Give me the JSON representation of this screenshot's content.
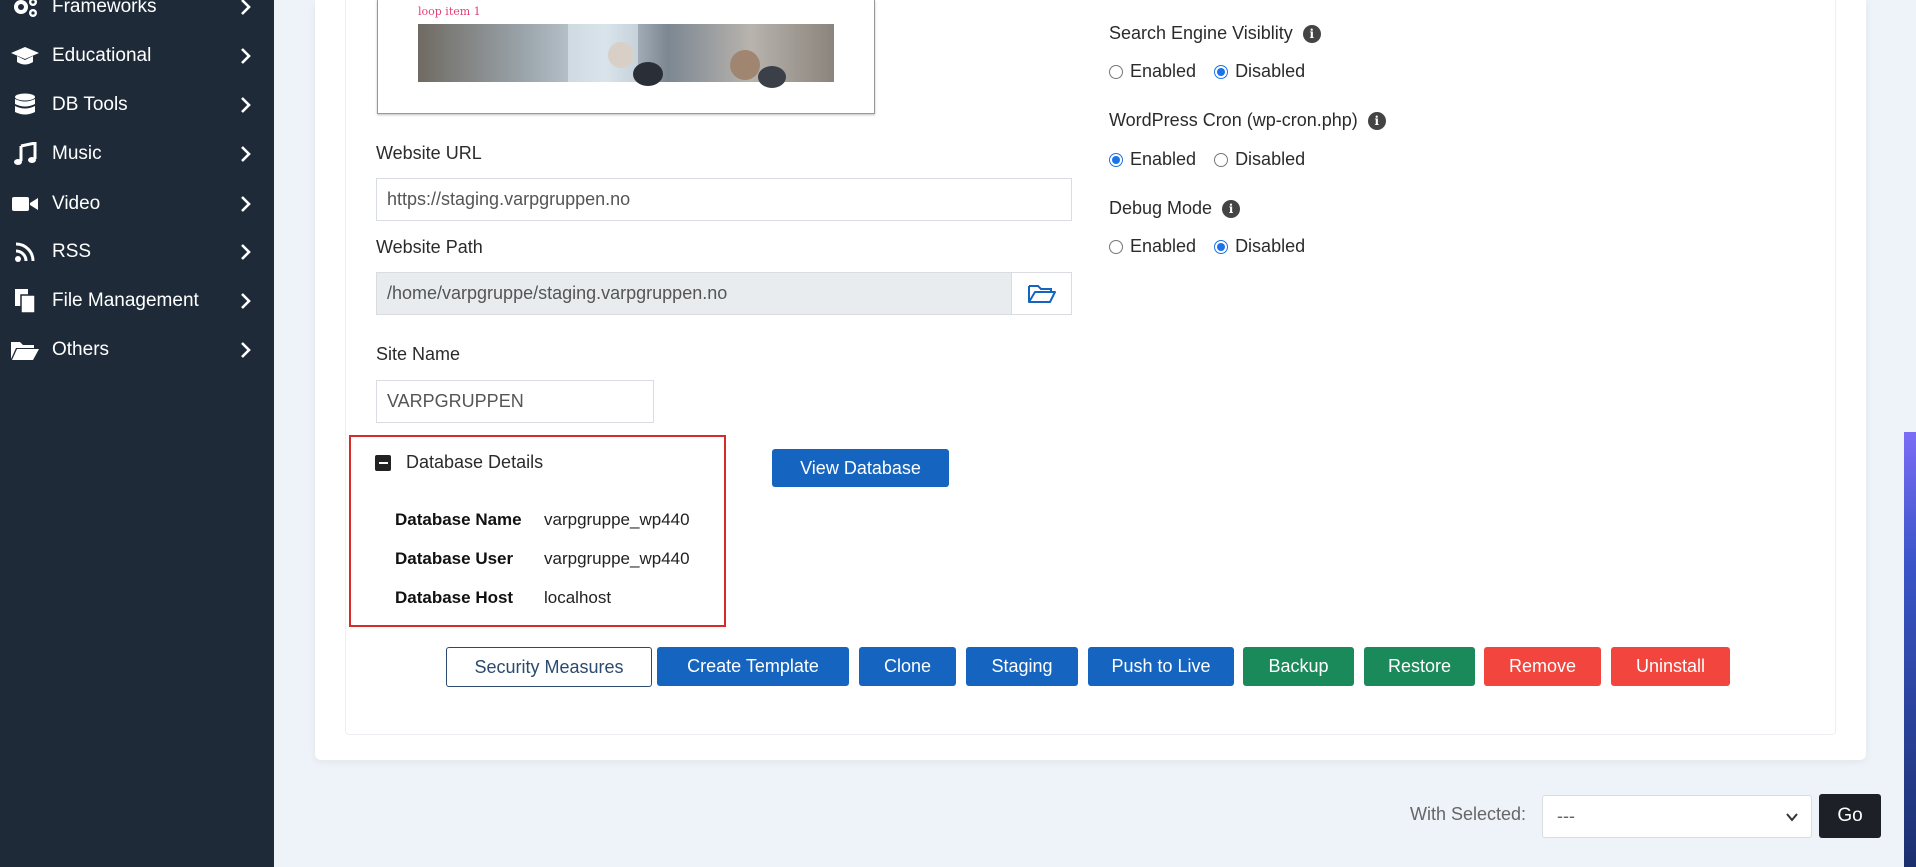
{
  "sidebar": {
    "items": [
      {
        "label": "Frameworks",
        "icon": "gears-icon"
      },
      {
        "label": "Educational",
        "icon": "graduation-cap-icon"
      },
      {
        "label": "DB Tools",
        "icon": "database-icon"
      },
      {
        "label": "Music",
        "icon": "music-note-icon"
      },
      {
        "label": "Video",
        "icon": "video-camera-icon"
      },
      {
        "label": "RSS",
        "icon": "rss-icon"
      },
      {
        "label": "File Management",
        "icon": "files-icon"
      },
      {
        "label": "Others",
        "icon": "folder-open-icon"
      }
    ]
  },
  "preview": {
    "caption": "loop item 1"
  },
  "form": {
    "website_url_label": "Website URL",
    "website_url_value": "https://staging.varpgruppen.no",
    "website_path_label": "Website Path",
    "website_path_value": "/home/varpgruppe/staging.varpgruppen.no",
    "site_name_label": "Site Name",
    "site_name_value": "VARPGRUPPEN"
  },
  "database": {
    "title": "Database Details",
    "rows": [
      {
        "key": "Database Name",
        "value": "varpgruppe_wp440"
      },
      {
        "key": "Database User",
        "value": "varpgruppe_wp440"
      },
      {
        "key": "Database Host",
        "value": "localhost"
      }
    ],
    "view_button": "View Database"
  },
  "settings": [
    {
      "label": "Search Engine Visiblity",
      "enabled_label": "Enabled",
      "disabled_label": "Disabled",
      "selected": "Disabled"
    },
    {
      "label": "WordPress Cron (wp-cron.php)",
      "enabled_label": "Enabled",
      "disabled_label": "Disabled",
      "selected": "Enabled"
    },
    {
      "label": "Debug Mode",
      "enabled_label": "Enabled",
      "disabled_label": "Disabled",
      "selected": "Disabled"
    }
  ],
  "actions": {
    "security": "Security Measures",
    "create_template": "Create Template",
    "clone": "Clone",
    "staging": "Staging",
    "push_live": "Push to Live",
    "backup": "Backup",
    "restore": "Restore",
    "remove": "Remove",
    "uninstall": "Uninstall"
  },
  "bulk": {
    "label": "With Selected:",
    "selected": "---",
    "go": "Go"
  },
  "colors": {
    "sidebar_bg": "#1e2a38",
    "primary": "#1565c0",
    "success": "#1a8a5a",
    "danger": "#f2453d",
    "highlight_border": "#d62b2b"
  }
}
